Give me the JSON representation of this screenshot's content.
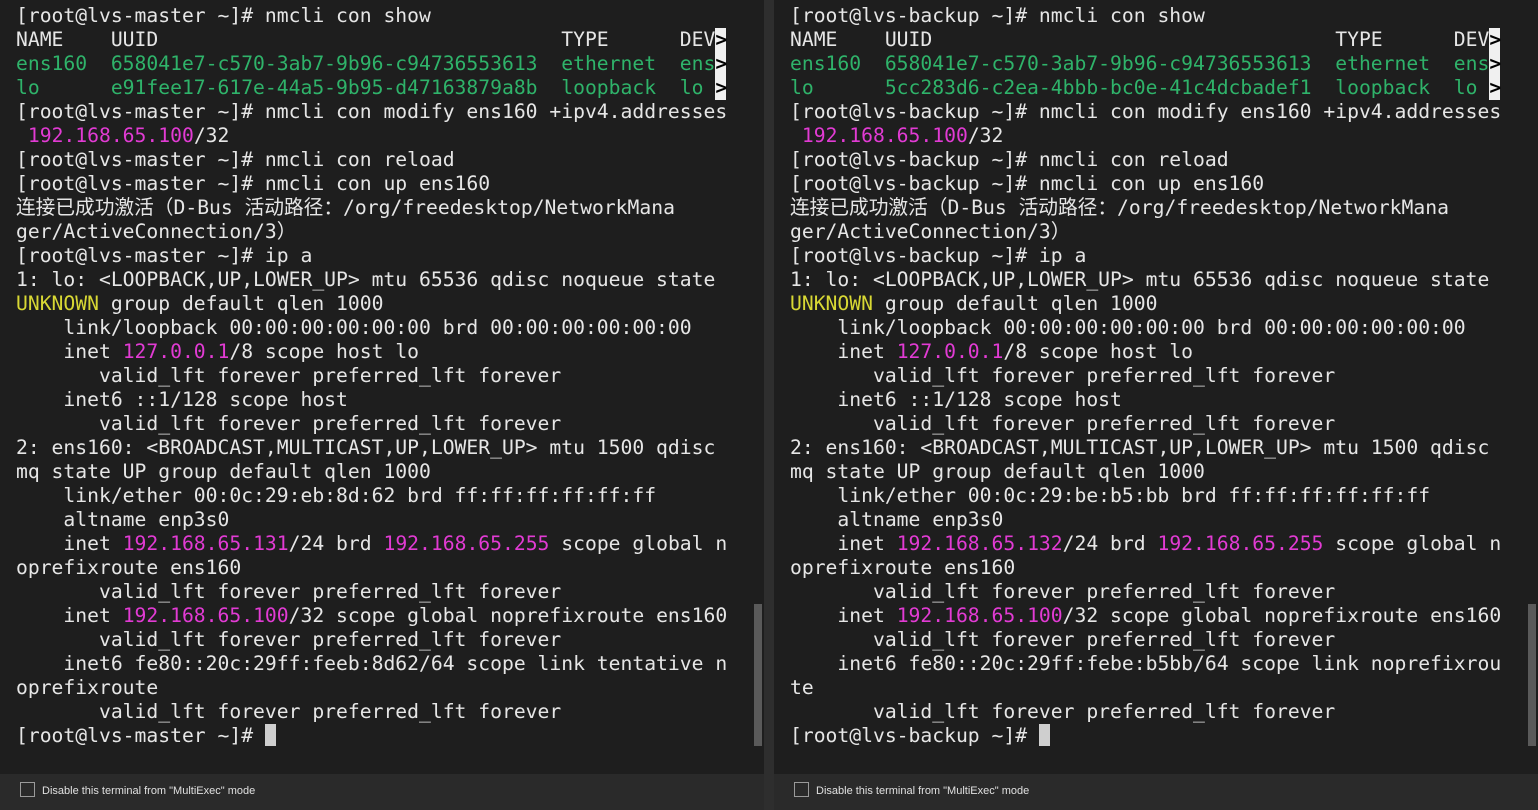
{
  "footer": {
    "label": "Disable this terminal from \"MultiExec\" mode"
  },
  "colors": {
    "green": "#2fb36a",
    "magenta": "#e23bd4",
    "yellow": "#d8d834",
    "text": "#e6e6e6"
  },
  "icons": {
    "truncation": "truncation-arrow-icon",
    "cursor": "cursor-block-icon"
  },
  "terminals": [
    {
      "host": "lvs-master",
      "lines": [
        [
          [
            "[root@lvs-master ~]# nmcli con show",
            ""
          ]
        ],
        [
          [
            "NAME    UUID                                  TYPE      DEV",
            ""
          ],
          [
            ">",
            "trunc"
          ]
        ],
        [
          [
            "ens160  658041e7-c570-3ab7-9b96-c94736553613  ethernet  ens",
            "g"
          ],
          [
            ">",
            "trunc"
          ]
        ],
        [
          [
            "lo      e91fee17-617e-44a5-9b95-d47163879a8b  loopback  lo ",
            "g"
          ],
          [
            ">",
            "trunc"
          ]
        ],
        [
          [
            "[root@lvs-master ~]# nmcli con modify ens160 +ipv4.addresses",
            ""
          ]
        ],
        [
          [
            " ",
            ""
          ],
          [
            "192.168.65.100",
            "m"
          ],
          [
            "/32",
            ""
          ]
        ],
        [
          [
            "[root@lvs-master ~]# nmcli con reload",
            ""
          ]
        ],
        [
          [
            "[root@lvs-master ~]# nmcli con up ens160",
            ""
          ]
        ],
        [
          [
            "连接已成功激活（D-Bus 活动路径：/org/freedesktop/NetworkMana",
            ""
          ]
        ],
        [
          [
            "ger/ActiveConnection/3）",
            ""
          ]
        ],
        [
          [
            "[root@lvs-master ~]# ip a",
            ""
          ]
        ],
        [
          [
            "1: lo: <LOOPBACK,UP,LOWER_UP> mtu 65536 qdisc noqueue state",
            ""
          ]
        ],
        [
          [
            "UNKNOWN",
            "y"
          ],
          [
            " group default qlen 1000",
            ""
          ]
        ],
        [
          [
            "    link/loopback 00:00:00:00:00:00 brd 00:00:00:00:00:00",
            ""
          ]
        ],
        [
          [
            "    inet ",
            ""
          ],
          [
            "127.0.0.1",
            "m"
          ],
          [
            "/8 scope host lo",
            ""
          ]
        ],
        [
          [
            "       valid_lft forever preferred_lft forever",
            ""
          ]
        ],
        [
          [
            "    inet6 ::1/128 scope host",
            ""
          ]
        ],
        [
          [
            "       valid_lft forever preferred_lft forever",
            ""
          ]
        ],
        [
          [
            "2: ens160: <BROADCAST,MULTICAST,UP,LOWER_UP> mtu 1500 qdisc",
            ""
          ]
        ],
        [
          [
            "mq state UP group default qlen 1000",
            ""
          ]
        ],
        [
          [
            "    link/ether 00:0c:29:eb:8d:62 brd ff:ff:ff:ff:ff:ff",
            ""
          ]
        ],
        [
          [
            "    altname enp3s0",
            ""
          ]
        ],
        [
          [
            "    inet ",
            ""
          ],
          [
            "192.168.65.131",
            "m"
          ],
          [
            "/24 brd ",
            ""
          ],
          [
            "192.168.65.255",
            "m"
          ],
          [
            " scope global n",
            ""
          ]
        ],
        [
          [
            "oprefixroute ens160",
            ""
          ]
        ],
        [
          [
            "       valid_lft forever preferred_lft forever",
            ""
          ]
        ],
        [
          [
            "    inet ",
            ""
          ],
          [
            "192.168.65.100",
            "m"
          ],
          [
            "/32 scope global noprefixroute ens160",
            ""
          ]
        ],
        [
          [
            "       valid_lft forever preferred_lft forever",
            ""
          ]
        ],
        [
          [
            "    inet6 fe80::20c:29ff:feeb:8d62/64 scope link tentative n",
            ""
          ]
        ],
        [
          [
            "oprefixroute",
            ""
          ]
        ],
        [
          [
            "       valid_lft forever preferred_lft forever",
            ""
          ]
        ],
        [
          [
            "[root@lvs-master ~]# ",
            ""
          ],
          [
            "",
            "cursor"
          ]
        ]
      ]
    },
    {
      "host": "lvs-backup",
      "lines": [
        [
          [
            "[root@lvs-backup ~]# nmcli con show",
            ""
          ]
        ],
        [
          [
            "NAME    UUID                                  TYPE      DEV",
            ""
          ],
          [
            ">",
            "trunc"
          ]
        ],
        [
          [
            "ens160  658041e7-c570-3ab7-9b96-c94736553613  ethernet  ens",
            "g"
          ],
          [
            ">",
            "trunc"
          ]
        ],
        [
          [
            "lo      5cc283d6-c2ea-4bbb-bc0e-41c4dcbadef1  loopback  lo ",
            "g"
          ],
          [
            ">",
            "trunc"
          ]
        ],
        [
          [
            "[root@lvs-backup ~]# nmcli con modify ens160 +ipv4.addresses",
            ""
          ]
        ],
        [
          [
            " ",
            ""
          ],
          [
            "192.168.65.100",
            "m"
          ],
          [
            "/32",
            ""
          ]
        ],
        [
          [
            "[root@lvs-backup ~]# nmcli con reload",
            ""
          ]
        ],
        [
          [
            "[root@lvs-backup ~]# nmcli con up ens160",
            ""
          ]
        ],
        [
          [
            "连接已成功激活（D-Bus 活动路径：/org/freedesktop/NetworkMana",
            ""
          ]
        ],
        [
          [
            "ger/ActiveConnection/3）",
            ""
          ]
        ],
        [
          [
            "[root@lvs-backup ~]# ip a",
            ""
          ]
        ],
        [
          [
            "1: lo: <LOOPBACK,UP,LOWER_UP> mtu 65536 qdisc noqueue state",
            ""
          ]
        ],
        [
          [
            "UNKNOWN",
            "y"
          ],
          [
            " group default qlen 1000",
            ""
          ]
        ],
        [
          [
            "    link/loopback 00:00:00:00:00:00 brd 00:00:00:00:00:00",
            ""
          ]
        ],
        [
          [
            "    inet ",
            ""
          ],
          [
            "127.0.0.1",
            "m"
          ],
          [
            "/8 scope host lo",
            ""
          ]
        ],
        [
          [
            "       valid_lft forever preferred_lft forever",
            ""
          ]
        ],
        [
          [
            "    inet6 ::1/128 scope host",
            ""
          ]
        ],
        [
          [
            "       valid_lft forever preferred_lft forever",
            ""
          ]
        ],
        [
          [
            "2: ens160: <BROADCAST,MULTICAST,UP,LOWER_UP> mtu 1500 qdisc",
            ""
          ]
        ],
        [
          [
            "mq state UP group default qlen 1000",
            ""
          ]
        ],
        [
          [
            "    link/ether 00:0c:29:be:b5:bb brd ff:ff:ff:ff:ff:ff",
            ""
          ]
        ],
        [
          [
            "    altname enp3s0",
            ""
          ]
        ],
        [
          [
            "    inet ",
            ""
          ],
          [
            "192.168.65.132",
            "m"
          ],
          [
            "/24 brd ",
            ""
          ],
          [
            "192.168.65.255",
            "m"
          ],
          [
            " scope global n",
            ""
          ]
        ],
        [
          [
            "oprefixroute ens160",
            ""
          ]
        ],
        [
          [
            "       valid_lft forever preferred_lft forever",
            ""
          ]
        ],
        [
          [
            "    inet ",
            ""
          ],
          [
            "192.168.65.100",
            "m"
          ],
          [
            "/32 scope global noprefixroute ens160",
            ""
          ]
        ],
        [
          [
            "       valid_lft forever preferred_lft forever",
            ""
          ]
        ],
        [
          [
            "    inet6 fe80::20c:29ff:febe:b5bb/64 scope link noprefixrou",
            ""
          ]
        ],
        [
          [
            "te",
            ""
          ]
        ],
        [
          [
            "       valid_lft forever preferred_lft forever",
            ""
          ]
        ],
        [
          [
            "[root@lvs-backup ~]# ",
            ""
          ],
          [
            "",
            "cursor"
          ]
        ]
      ]
    }
  ]
}
